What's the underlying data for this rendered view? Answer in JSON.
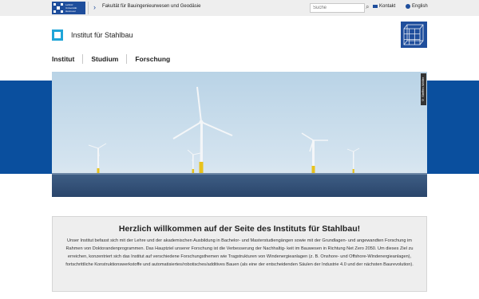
{
  "topbar": {
    "university_logo_text": [
      "Leibniz",
      "Universität",
      "Hannover"
    ],
    "breadcrumb": "Fakultät für Bauingenieurwesen und Geodäsie",
    "search_placeholder": "Suche",
    "contact_label": "Kontakt",
    "language_label": "English"
  },
  "header": {
    "institute_name": "Institut für Stahlbau"
  },
  "nav": {
    "items": [
      {
        "label": "Institut"
      },
      {
        "label": "Studium"
      },
      {
        "label": "Forschung"
      }
    ]
  },
  "hero": {
    "image_subject": "offshore wind turbines",
    "photo_credit": "© Steffen Wöller"
  },
  "welcome": {
    "title": "Herzlich willkommen auf der Seite des Instituts für Stahlbau!",
    "body": "Unser Institut befasst sich mit der Lehre und der akademischen Ausbildung in Bachelor- und Masterstudiengängen sowie mit der Grundlagen- und angewandten Forschung im Rahmen von Doktorandenprogrammen. Das Hauptziel unserer Forschung ist die Verbesserung der Nachhaltig- keit im Bauwesen in Richtung Net Zero 2050. Um dieses Ziel zu erreichen, konzentriert sich das Institut auf verschiedene Forschungsthemen wie Tragstrukturen von Windenergieanlagen (z. B. Onshore- und Offshore-Windenergieanlagen), fortschrittliche Konstruktionswerkstoffe und automatisiertes/robotisches/additives Bauen (als eine der entscheidenden Säulen der Industrie 4.0 und der nächsten Baurevolution)."
  },
  "colors": {
    "brand_blue": "#0a4f9e",
    "logo_blue": "#1f4e9c",
    "accent_cyan": "#1fa5d8",
    "topbar_bg": "#eeeeee"
  }
}
